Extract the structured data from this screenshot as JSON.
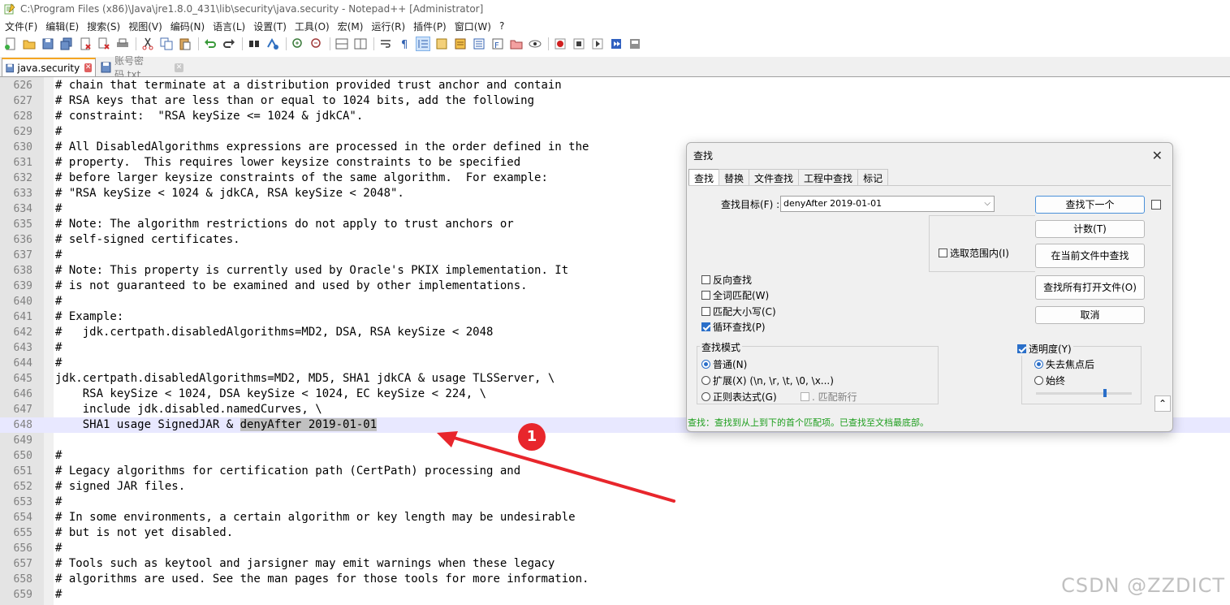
{
  "window": {
    "title": "C:\\Program Files (x86)\\Java\\jre1.8.0_431\\lib\\security\\java.security - Notepad++ [Administrator]"
  },
  "menu": [
    "文件(F)",
    "编辑(E)",
    "搜索(S)",
    "视图(V)",
    "编码(N)",
    "语言(L)",
    "设置(T)",
    "工具(O)",
    "宏(M)",
    "运行(R)",
    "插件(P)",
    "窗口(W)",
    "?"
  ],
  "tabs": [
    {
      "label": "java.security",
      "active": true
    },
    {
      "label": "账号密码.txt",
      "active": false
    }
  ],
  "editor": {
    "lines": [
      {
        "n": "626",
        "t": "# chain that terminate at a distribution provided trust anchor and contain"
      },
      {
        "n": "627",
        "t": "# RSA keys that are less than or equal to 1024 bits, add the following"
      },
      {
        "n": "628",
        "t": "# constraint:  \"RSA keySize <= 1024 & jdkCA\"."
      },
      {
        "n": "629",
        "t": "#"
      },
      {
        "n": "630",
        "t": "# All DisabledAlgorithms expressions are processed in the order defined in the"
      },
      {
        "n": "631",
        "t": "# property.  This requires lower keysize constraints to be specified"
      },
      {
        "n": "632",
        "t": "# before larger keysize constraints of the same algorithm.  For example:"
      },
      {
        "n": "633",
        "t": "# \"RSA keySize < 1024 & jdkCA, RSA keySize < 2048\"."
      },
      {
        "n": "634",
        "t": "#"
      },
      {
        "n": "635",
        "t": "# Note: The algorithm restrictions do not apply to trust anchors or"
      },
      {
        "n": "636",
        "t": "# self-signed certificates."
      },
      {
        "n": "637",
        "t": "#"
      },
      {
        "n": "638",
        "t": "# Note: This property is currently used by Oracle's PKIX implementation. It"
      },
      {
        "n": "639",
        "t": "# is not guaranteed to be examined and used by other implementations."
      },
      {
        "n": "640",
        "t": "#"
      },
      {
        "n": "641",
        "t": "# Example:"
      },
      {
        "n": "642",
        "t": "#   jdk.certpath.disabledAlgorithms=MD2, DSA, RSA keySize < 2048"
      },
      {
        "n": "643",
        "t": "#"
      },
      {
        "n": "644",
        "t": "#"
      },
      {
        "n": "645",
        "t": "jdk.certpath.disabledAlgorithms=MD2, MD5, SHA1 jdkCA & usage TLSServer, \\"
      },
      {
        "n": "646",
        "t": "    RSA keySize < 1024, DSA keySize < 1024, EC keySize < 224, \\"
      },
      {
        "n": "647",
        "t": "    include jdk.disabled.namedCurves, \\"
      },
      {
        "n": "648",
        "t": "    SHA1 usage SignedJAR & ",
        "match": "denyAfter 2019-01-01",
        "current": true
      },
      {
        "n": "649",
        "t": ""
      },
      {
        "n": "650",
        "t": "#"
      },
      {
        "n": "651",
        "t": "# Legacy algorithms for certification path (CertPath) processing and"
      },
      {
        "n": "652",
        "t": "# signed JAR files."
      },
      {
        "n": "653",
        "t": "#"
      },
      {
        "n": "654",
        "t": "# In some environments, a certain algorithm or key length may be undesirable"
      },
      {
        "n": "655",
        "t": "# but is not yet disabled."
      },
      {
        "n": "656",
        "t": "#"
      },
      {
        "n": "657",
        "t": "# Tools such as keytool and jarsigner may emit warnings when these legacy"
      },
      {
        "n": "658",
        "t": "# algorithms are used. See the man pages for those tools for more information."
      },
      {
        "n": "659",
        "t": "#"
      }
    ]
  },
  "find_dialog": {
    "title": "查找",
    "tabs": [
      "查找",
      "替换",
      "文件查找",
      "工程中查找",
      "标记"
    ],
    "target_label": "查找目标(F) :",
    "target_value": "denyAfter 2019-01-01",
    "buttons": {
      "find_next": "查找下一个",
      "count": "计数(T)",
      "find_in_current": "在当前文件中查找",
      "find_all_open": "查找所有打开文件(O)",
      "cancel": "取消"
    },
    "in_selection": "选取范围内(I)",
    "options": {
      "backward": {
        "label": "反向查找",
        "checked": false
      },
      "whole_word": {
        "label": "全词匹配(W)",
        "checked": false
      },
      "match_case": {
        "label": "匹配大小写(C)",
        "checked": false
      },
      "wrap": {
        "label": "循环查找(P)",
        "checked": true
      }
    },
    "search_mode": {
      "title": "查找模式",
      "normal": "普通(N)",
      "extended": "扩展(X) (\\n, \\r, \\t, \\0, \\x...)",
      "regex": "正则表达式(G)",
      "dot_newline": ". 匹配新行"
    },
    "transparency": {
      "label": "透明度(Y)",
      "checked": true,
      "on_lose_focus": "失去焦点后",
      "always": "始终",
      "level": 0.72
    },
    "status": "查找：查找到从上到下的首个匹配项。已查找至文档最底部。"
  },
  "annotation": {
    "badge": "1"
  },
  "watermark": "CSDN @ZZDICT"
}
